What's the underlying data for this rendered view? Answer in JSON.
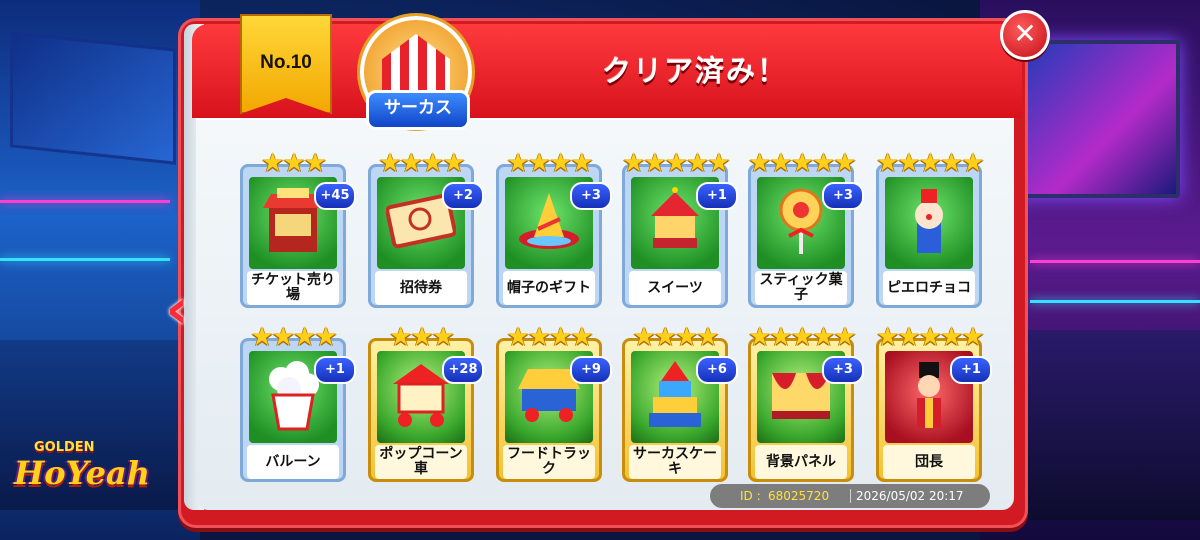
{
  "header": {
    "level_badge": "No.10",
    "theme_label": "サーカス",
    "title": "クリア済み！"
  },
  "cards": [
    {
      "label": "チケット売り場",
      "count": "+45",
      "stars": "★★★",
      "star_count": 3,
      "style": "normal"
    },
    {
      "label": "招待券",
      "count": "+2",
      "stars": "★★★★",
      "star_count": 4,
      "style": "normal"
    },
    {
      "label": "帽子のギフト",
      "count": "+3",
      "stars": "★★★★",
      "star_count": 4,
      "style": "normal"
    },
    {
      "label": "スイーツ",
      "count": "+1",
      "stars": "★★★★★",
      "star_count": 5,
      "style": "normal"
    },
    {
      "label": "スティック菓子",
      "count": "+3",
      "stars": "★★★★★",
      "star_count": 5,
      "style": "normal"
    },
    {
      "label": "ピエロチョコ",
      "count": "",
      "stars": "★★★★★",
      "star_count": 5,
      "style": "normal"
    },
    {
      "label": "バルーン",
      "count": "+1",
      "stars": "★★★★",
      "star_count": 4,
      "style": "normal"
    },
    {
      "label": "ポップコーン車",
      "count": "+28",
      "stars": "★★★",
      "star_count": 3,
      "style": "gold"
    },
    {
      "label": "フードトラック",
      "count": "+9",
      "stars": "★★★★",
      "star_count": 4,
      "style": "gold"
    },
    {
      "label": "サーカスケーキ",
      "count": "+6",
      "stars": "★★★★",
      "star_count": 4,
      "style": "gold"
    },
    {
      "label": "背景パネル",
      "count": "+3",
      "stars": "★★★★★",
      "star_count": 5,
      "style": "gold"
    },
    {
      "label": "団長",
      "count": "+1",
      "stars": "★★★★★",
      "star_count": 5,
      "style": "gold-red"
    }
  ],
  "footer": {
    "id_label": "ID :",
    "id_value": "68025720",
    "datetime": "2026/05/02 20:17"
  },
  "logo": {
    "top": "GOLDEN",
    "main": "HoYeah"
  },
  "icons": {
    "close": "close-icon",
    "back": "chevron-left-icon"
  },
  "colors": {
    "panel_red": "#d11a22",
    "star_gold": "#ffcf1a",
    "count_badge_blue": "#1530b8",
    "card_green": "#1f8f24"
  }
}
